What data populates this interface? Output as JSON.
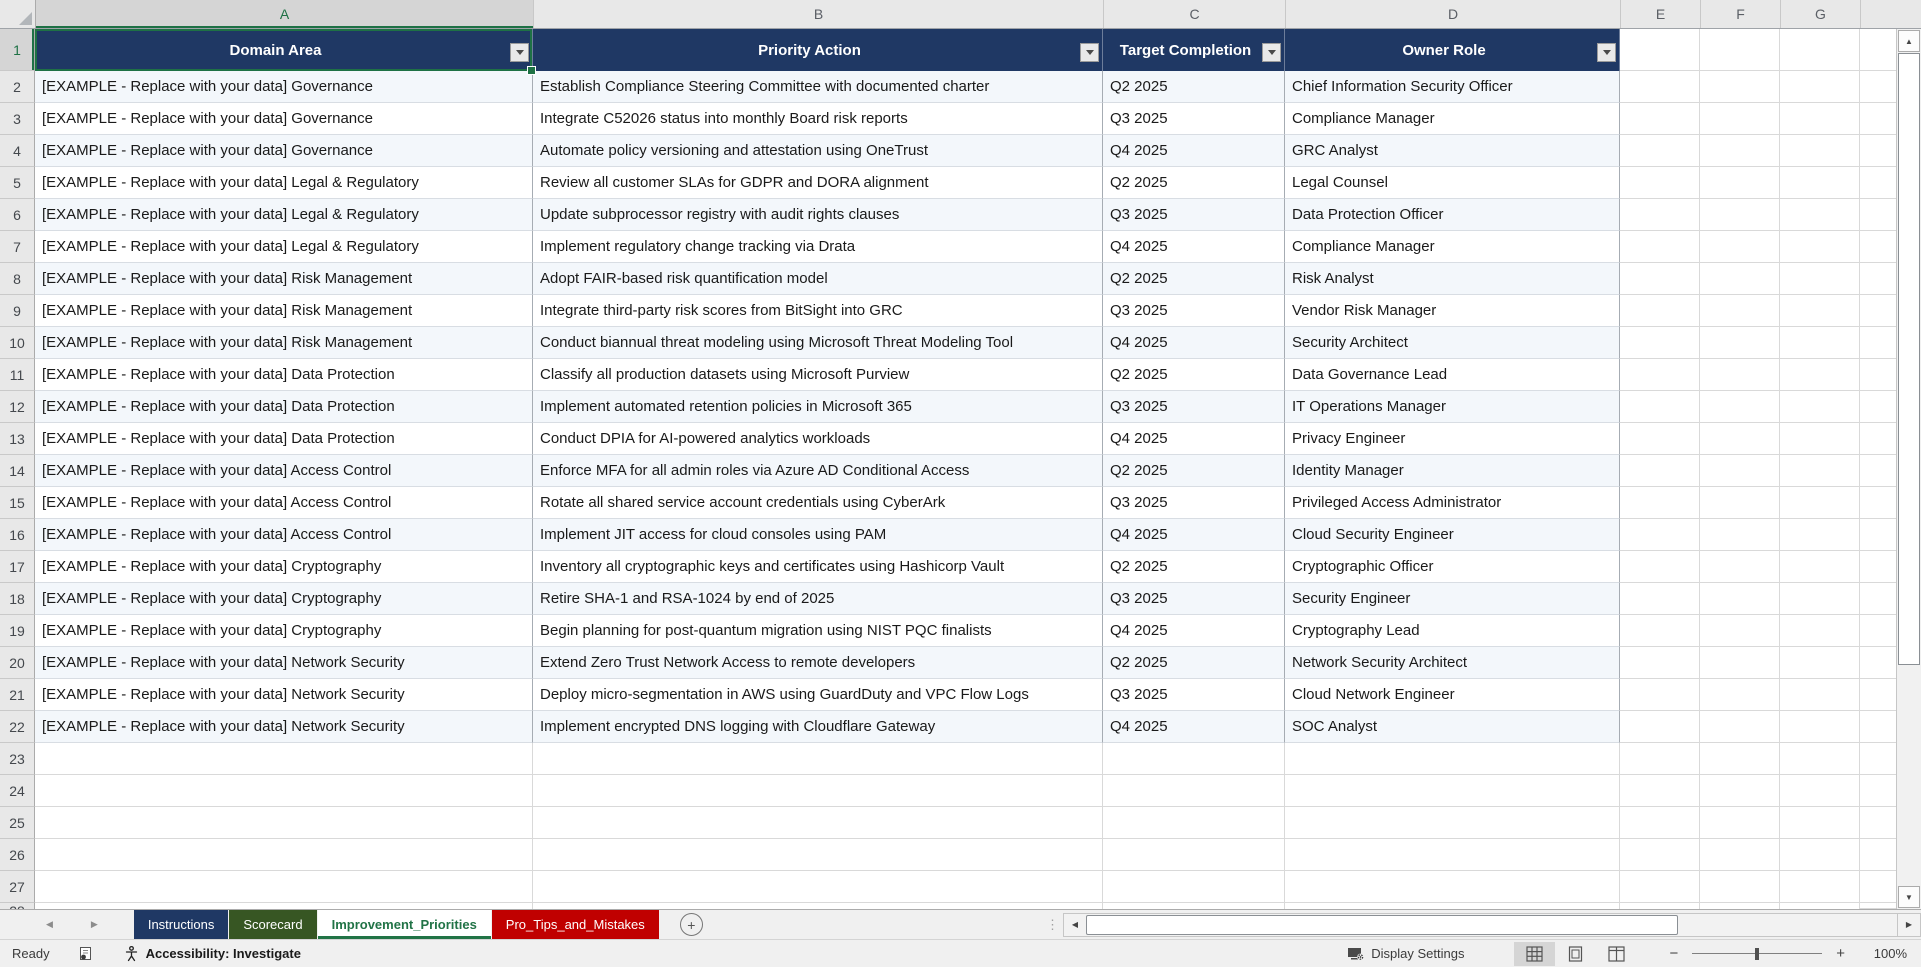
{
  "grid": {
    "column_letters": [
      "A",
      "B",
      "C",
      "D",
      "E",
      "F",
      "G"
    ],
    "selected_column": "A",
    "selected_row": 1,
    "selected_cell": "A1",
    "visible_rows": {
      "from": 1,
      "to": 28
    }
  },
  "table": {
    "headers": [
      {
        "label": "Domain Area"
      },
      {
        "label": "Priority Action"
      },
      {
        "label": "Target Completion"
      },
      {
        "label": "Owner Role"
      }
    ],
    "rows": [
      {
        "row": 2,
        "cells": [
          "[EXAMPLE - Replace with your data] Governance",
          "Establish Compliance Steering Committee with documented charter",
          "Q2 2025",
          "Chief Information Security Officer"
        ]
      },
      {
        "row": 3,
        "cells": [
          "[EXAMPLE - Replace with your data] Governance",
          "Integrate C52026 status into monthly Board risk reports",
          "Q3 2025",
          "Compliance Manager"
        ]
      },
      {
        "row": 4,
        "cells": [
          "[EXAMPLE - Replace with your data] Governance",
          "Automate policy versioning and attestation using OneTrust",
          "Q4 2025",
          "GRC Analyst"
        ]
      },
      {
        "row": 5,
        "cells": [
          "[EXAMPLE - Replace with your data] Legal & Regulatory",
          "Review all customer SLAs for GDPR and DORA alignment",
          "Q2 2025",
          "Legal Counsel"
        ]
      },
      {
        "row": 6,
        "cells": [
          "[EXAMPLE - Replace with your data] Legal & Regulatory",
          "Update subprocessor registry with audit rights clauses",
          "Q3 2025",
          "Data Protection Officer"
        ]
      },
      {
        "row": 7,
        "cells": [
          "[EXAMPLE - Replace with your data] Legal & Regulatory",
          "Implement regulatory change tracking via Drata",
          "Q4 2025",
          "Compliance Manager"
        ]
      },
      {
        "row": 8,
        "cells": [
          "[EXAMPLE - Replace with your data] Risk Management",
          "Adopt FAIR-based risk quantification model",
          "Q2 2025",
          "Risk Analyst"
        ]
      },
      {
        "row": 9,
        "cells": [
          "[EXAMPLE - Replace with your data] Risk Management",
          "Integrate third-party risk scores from BitSight into GRC",
          "Q3 2025",
          "Vendor Risk Manager"
        ]
      },
      {
        "row": 10,
        "cells": [
          "[EXAMPLE - Replace with your data] Risk Management",
          "Conduct biannual threat modeling using Microsoft Threat Modeling Tool",
          "Q4 2025",
          "Security Architect"
        ]
      },
      {
        "row": 11,
        "cells": [
          "[EXAMPLE - Replace with your data] Data Protection",
          "Classify all production datasets using Microsoft Purview",
          "Q2 2025",
          "Data Governance Lead"
        ]
      },
      {
        "row": 12,
        "cells": [
          "[EXAMPLE - Replace with your data] Data Protection",
          "Implement automated retention policies in Microsoft 365",
          "Q3 2025",
          "IT Operations Manager"
        ]
      },
      {
        "row": 13,
        "cells": [
          "[EXAMPLE - Replace with your data] Data Protection",
          "Conduct DPIA for AI-powered analytics workloads",
          "Q4 2025",
          "Privacy Engineer"
        ]
      },
      {
        "row": 14,
        "cells": [
          "[EXAMPLE - Replace with your data] Access Control",
          "Enforce MFA for all admin roles via Azure AD Conditional Access",
          "Q2 2025",
          "Identity Manager"
        ]
      },
      {
        "row": 15,
        "cells": [
          "[EXAMPLE - Replace with your data] Access Control",
          "Rotate all shared service account credentials using CyberArk",
          "Q3 2025",
          "Privileged Access Administrator"
        ]
      },
      {
        "row": 16,
        "cells": [
          "[EXAMPLE - Replace with your data] Access Control",
          "Implement JIT access for cloud consoles using PAM",
          "Q4 2025",
          "Cloud Security Engineer"
        ]
      },
      {
        "row": 17,
        "cells": [
          "[EXAMPLE - Replace with your data] Cryptography",
          "Inventory all cryptographic keys and certificates using Hashicorp Vault",
          "Q2 2025",
          "Cryptographic Officer"
        ]
      },
      {
        "row": 18,
        "cells": [
          "[EXAMPLE - Replace with your data] Cryptography",
          "Retire SHA-1 and RSA-1024 by end of 2025",
          "Q3 2025",
          "Security Engineer"
        ]
      },
      {
        "row": 19,
        "cells": [
          "[EXAMPLE - Replace with your data] Cryptography",
          "Begin planning for post-quantum migration using NIST PQC finalists",
          "Q4 2025",
          "Cryptography Lead"
        ]
      },
      {
        "row": 20,
        "cells": [
          "[EXAMPLE - Replace with your data] Network Security",
          "Extend Zero Trust Network Access to remote developers",
          "Q2 2025",
          "Network Security Architect"
        ]
      },
      {
        "row": 21,
        "cells": [
          "[EXAMPLE - Replace with your data] Network Security",
          "Deploy micro-segmentation in AWS using GuardDuty and VPC Flow Logs",
          "Q3 2025",
          "Cloud Network Engineer"
        ]
      },
      {
        "row": 22,
        "cells": [
          "[EXAMPLE - Replace with your data] Network Security",
          "Implement encrypted DNS logging with Cloudflare Gateway",
          "Q4 2025",
          "SOC Analyst"
        ]
      }
    ]
  },
  "sheet_tabs": {
    "items": [
      {
        "label": "Instructions",
        "bg": "#1F3864",
        "fg": "#FFFFFF",
        "active": false
      },
      {
        "label": "Scorecard",
        "bg": "#375623",
        "fg": "#FFFFFF",
        "active": false
      },
      {
        "label": "Improvement_Priorities",
        "bg": "#FFFFFF",
        "fg": "#217346",
        "active": true
      },
      {
        "label": "Pro_Tips_and_Mistakes",
        "bg": "#C00000",
        "fg": "#FFFFFF",
        "active": false
      }
    ],
    "add_sheet_label": "+"
  },
  "status_bar": {
    "ready_label": "Ready",
    "accessibility_label": "Accessibility: Investigate",
    "display_settings_label": "Display Settings",
    "zoom_out_label": "−",
    "zoom_in_label": "+",
    "zoom_level": "100%"
  },
  "colors": {
    "table_header_fill": "#1F3864",
    "band_fill": "#F3F7FB",
    "selection_green": "#1E7145",
    "active_tab_green": "#217346",
    "tab_red": "#C00000",
    "tab_navy": "#1F3864",
    "tab_dark_green": "#375623"
  }
}
